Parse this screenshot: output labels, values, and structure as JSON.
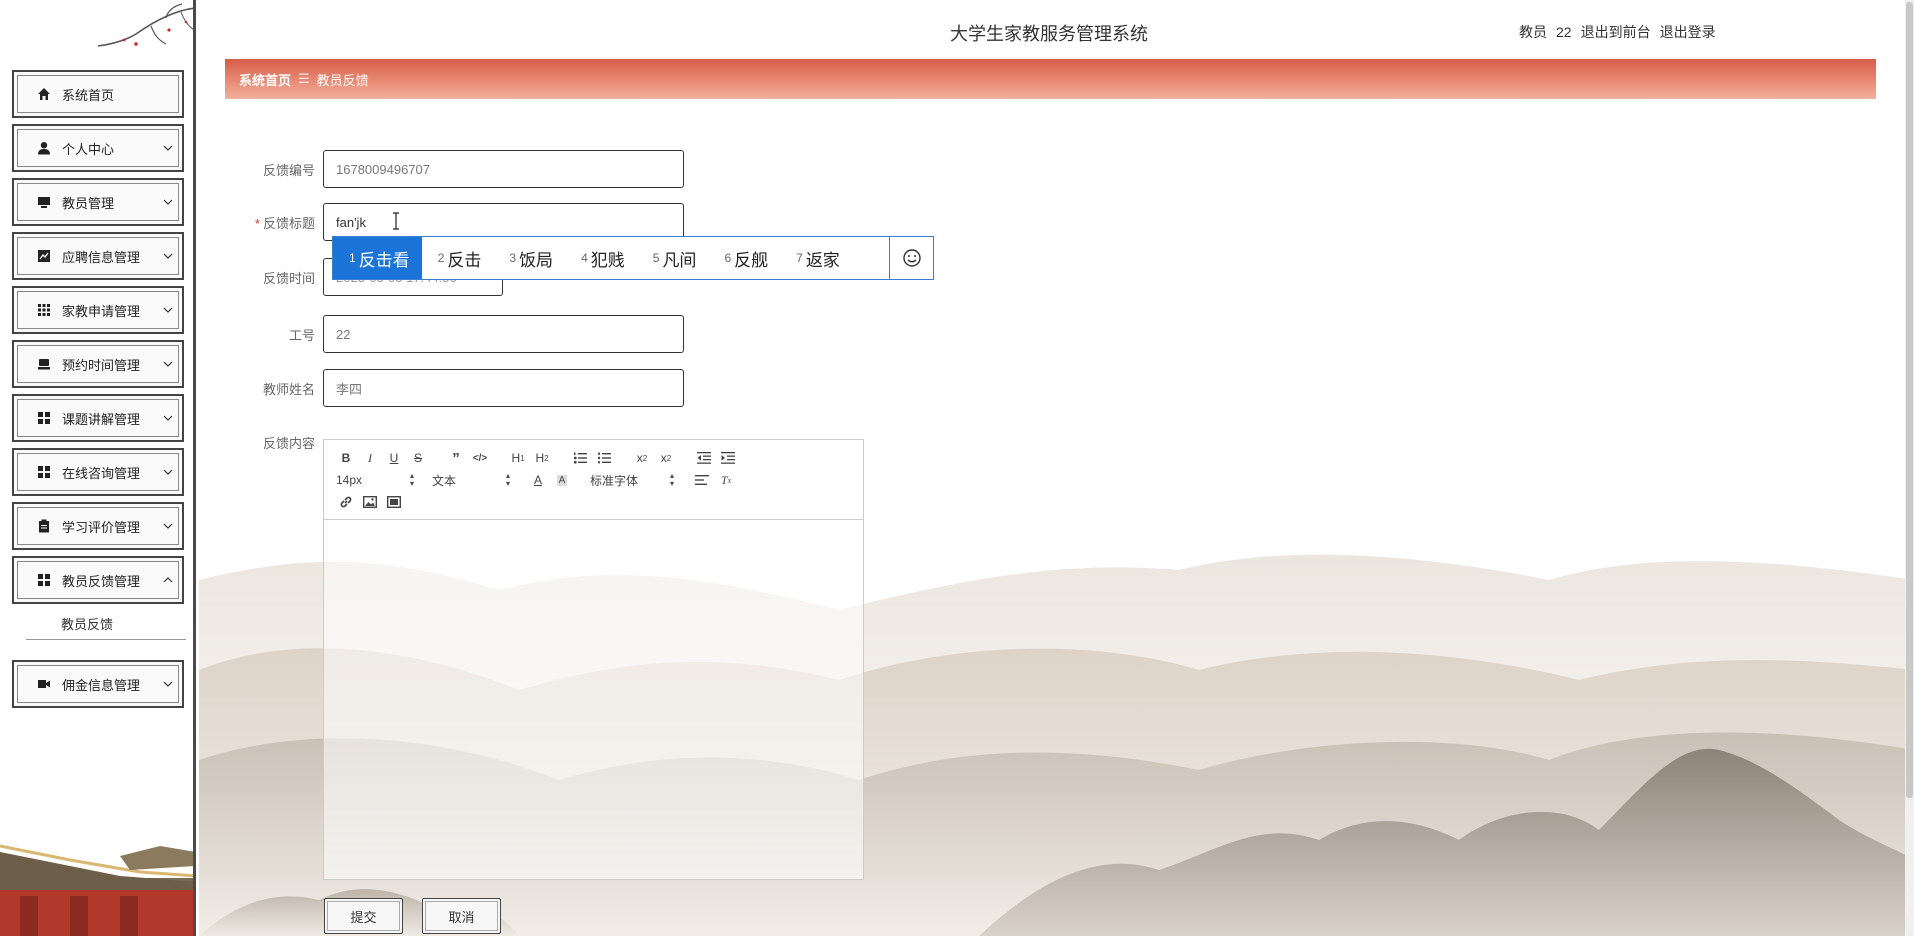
{
  "header": {
    "title": "大学生家教服务管理系统",
    "user_role": "教员",
    "user_id": "22",
    "to_front_label": "退出到前台",
    "logout_label": "退出登录"
  },
  "breadcrumb": {
    "home": "系统首页",
    "separator": "☰",
    "current": "教员反馈"
  },
  "sidebar": {
    "items": [
      {
        "label": "系统首页",
        "icon": "home-icon"
      },
      {
        "label": "个人中心",
        "icon": "user-icon"
      },
      {
        "label": "教员管理",
        "icon": "monitor-icon"
      },
      {
        "label": "应聘信息管理",
        "icon": "chart-icon"
      },
      {
        "label": "家教申请管理",
        "icon": "grid-icon"
      },
      {
        "label": "预约时间管理",
        "icon": "printer-icon"
      },
      {
        "label": "课题讲解管理",
        "icon": "apps-icon"
      },
      {
        "label": "在线咨询管理",
        "icon": "apps-icon"
      },
      {
        "label": "学习评价管理",
        "icon": "clipboard-icon"
      },
      {
        "label": "教员反馈管理",
        "icon": "apps-icon"
      },
      {
        "label": "佣金信息管理",
        "icon": "video-icon"
      }
    ],
    "submenu": {
      "label": "教员反馈"
    }
  },
  "form": {
    "fields": {
      "feedback_no": {
        "label": "反馈编号",
        "value": "1678009496707"
      },
      "feedback_title": {
        "label": "反馈标题",
        "value": "fan'jk"
      },
      "feedback_time": {
        "label": "反馈时间",
        "value": "2023-03-05 17:44:56"
      },
      "work_no": {
        "label": "工号",
        "value": "22"
      },
      "teacher_name": {
        "label": "教师姓名",
        "value": "李四"
      },
      "feedback_content": {
        "label": "反馈内容"
      }
    },
    "editor": {
      "font_size": "14px",
      "format": "文本",
      "font_family": "标准字体"
    },
    "submit_label": "提交",
    "cancel_label": "取消"
  },
  "ime": {
    "candidates": [
      {
        "n": "1",
        "text": "反击看"
      },
      {
        "n": "2",
        "text": "反击"
      },
      {
        "n": "3",
        "text": "饭局"
      },
      {
        "n": "4",
        "text": "犯贱"
      },
      {
        "n": "5",
        "text": "凡间"
      },
      {
        "n": "6",
        "text": "反舰"
      },
      {
        "n": "7",
        "text": "返家"
      }
    ]
  }
}
